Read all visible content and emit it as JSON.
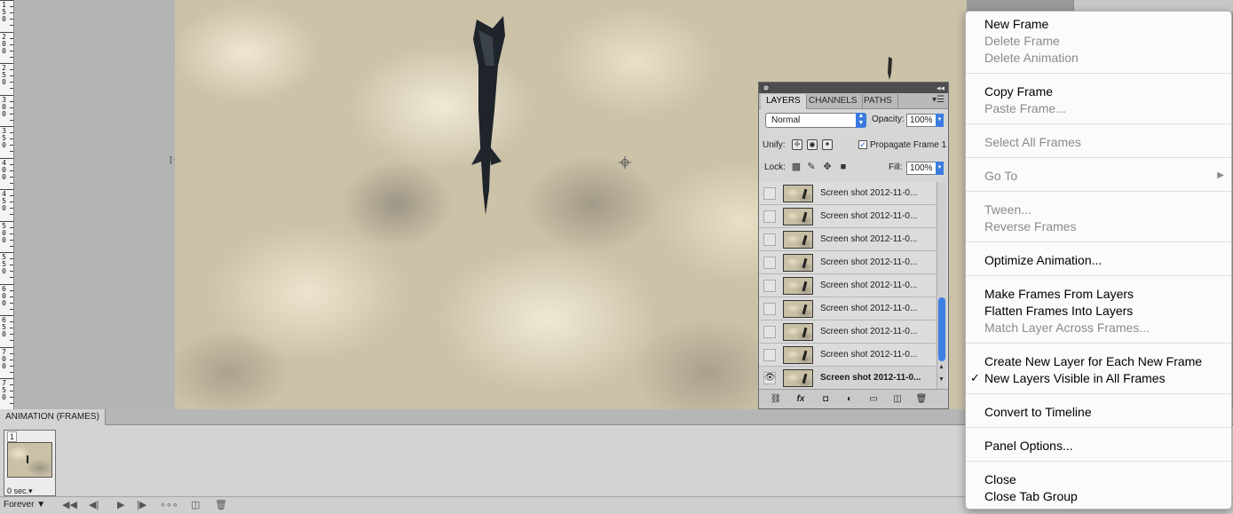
{
  "ruler": {
    "numbers": [
      "1\n5\n0",
      "2\n0\n0",
      "2\n5\n0",
      "3\n0\n0",
      "3\n5\n0",
      "4\n0\n0",
      "4\n5\n0",
      "5\n0\n0",
      "5\n5\n0",
      "6\n0\n0",
      "6\n5\n0",
      "7\n0\n0",
      "7\n5\n0"
    ]
  },
  "layers_panel": {
    "tabs": [
      "LAYERS",
      "CHANNELS",
      "PATHS"
    ],
    "blend_mode": "Normal",
    "opacity_label": "Opacity:",
    "opacity_value": "100%",
    "unify_label": "Unify:",
    "propagate_label": "Propagate Frame 1",
    "propagate_checked": "✓",
    "lock_label": "Lock:",
    "fill_label": "Fill:",
    "fill_value": "100%",
    "layers": [
      {
        "name": "Screen shot 2012-11-0..."
      },
      {
        "name": "Screen shot 2012-11-0..."
      },
      {
        "name": "Screen shot 2012-11-0..."
      },
      {
        "name": "Screen shot 2012-11-0..."
      },
      {
        "name": "Screen shot 2012-11-0..."
      },
      {
        "name": "Screen shot 2012-11-0..."
      },
      {
        "name": "Screen shot 2012-11-0..."
      },
      {
        "name": "Screen shot 2012-11-0..."
      },
      {
        "name": "Screen shot 2012-11-0..."
      }
    ],
    "footer_icons": [
      "link-icon",
      "fx-icon",
      "mask-icon",
      "adjustment-icon",
      "folder-icon",
      "new-layer-icon",
      "trash-icon"
    ]
  },
  "animation_panel": {
    "tab": "ANIMATION (FRAMES)",
    "frame_number": "1",
    "frame_delay": "0 sec.▾",
    "loop": "Forever ▼"
  },
  "context_menu": {
    "items": [
      {
        "label": "New Frame",
        "enabled": true
      },
      {
        "label": "Delete Frame",
        "enabled": false
      },
      {
        "label": "Delete Animation",
        "enabled": false
      },
      {
        "label": "Copy Frame",
        "enabled": true
      },
      {
        "label": "Paste Frame...",
        "enabled": false
      },
      {
        "label": "Select All Frames",
        "enabled": false
      },
      {
        "label": "Go To",
        "enabled": false
      },
      {
        "label": "Tween...",
        "enabled": false
      },
      {
        "label": "Reverse Frames",
        "enabled": false
      },
      {
        "label": "Optimize Animation...",
        "enabled": true
      },
      {
        "label": "Make Frames From Layers",
        "enabled": true
      },
      {
        "label": "Flatten Frames Into Layers",
        "enabled": true
      },
      {
        "label": "Match Layer Across Frames...",
        "enabled": false
      },
      {
        "label": "Create New Layer for Each New Frame",
        "enabled": true
      },
      {
        "label": "New Layers Visible in All Frames",
        "enabled": true,
        "checked": true
      },
      {
        "label": "Convert to Timeline",
        "enabled": true
      },
      {
        "label": "Panel Options...",
        "enabled": true
      },
      {
        "label": "Close",
        "enabled": true
      },
      {
        "label": "Close Tab Group",
        "enabled": true
      }
    ],
    "checkmark": "✓",
    "submenu_arrow": "▶"
  },
  "colors": {
    "accent": "#3b7be0",
    "menu_bg": "#fbfbfb",
    "disabled_text": "#8a8a8a"
  }
}
